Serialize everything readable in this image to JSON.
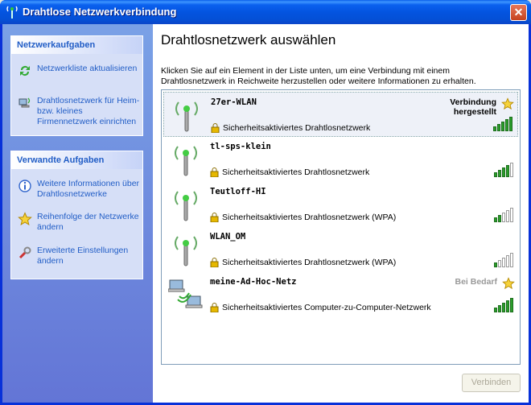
{
  "window": {
    "title": "Drahtlose Netzwerkverbindung",
    "close_icon": "close-icon"
  },
  "tasks": {
    "network_tasks": {
      "title": "Netzwerkaufgaben",
      "items": [
        {
          "label": "Netzwerkliste aktualisieren",
          "icon": "refresh-icon"
        },
        {
          "label": "Drahtlosnetzwerk für Heim- bzw. kleines Firmennetzwerk einrichten",
          "icon": "network-setup-icon"
        }
      ]
    },
    "related_tasks": {
      "title": "Verwandte Aufgaben",
      "items": [
        {
          "label": "Weitere Informationen über Drahtlosnetzwerke",
          "icon": "info-icon"
        },
        {
          "label": "Reihenfolge der Netzwerke ändern",
          "icon": "star-icon"
        },
        {
          "label": "Erweiterte Einstellungen ändern",
          "icon": "tools-icon"
        }
      ]
    }
  },
  "main": {
    "heading": "Drahtlosnetzwerk auswählen",
    "intro": "Klicken Sie auf ein Element in der Liste unten, um eine Verbindung mit einem Drahtlosnetzwerk in Reichweite herzustellen oder weitere Informationen zu erhalten.",
    "networks": [
      {
        "name": "27er-WLAN",
        "security": "Sicherheitsaktiviertes Drahtlosnetzwerk",
        "status_line1": "Verbindung",
        "status_line2": "hergestellt",
        "signal_bars": 5,
        "starred": true,
        "selected": true
      },
      {
        "name": "tl-sps-klein",
        "security": "Sicherheitsaktiviertes Drahtlosnetzwerk",
        "status_line1": "",
        "status_line2": "",
        "signal_bars": 4,
        "starred": false,
        "selected": false
      },
      {
        "name": "Teutloff-HI",
        "security": "Sicherheitsaktiviertes Drahtlosnetzwerk (WPA)",
        "status_line1": "",
        "status_line2": "",
        "signal_bars": 2,
        "starred": false,
        "selected": false
      },
      {
        "name": "WLAN_OM",
        "security": "Sicherheitsaktiviertes Drahtlosnetzwerk (WPA)",
        "status_line1": "",
        "status_line2": "",
        "signal_bars": 1,
        "starred": false,
        "selected": false
      },
      {
        "name": "meine-Ad-Hoc-Netz",
        "security": "Sicherheitsaktiviertes Computer-zu-Computer-Netzwerk",
        "status_line1": "Bei Bedarf",
        "status_line2": "",
        "signal_bars": 5,
        "starred": true,
        "selected": false
      }
    ],
    "connect_button": "Verbinden"
  },
  "colors": {
    "accent": "#215dc6",
    "signal_on": "#2a9d2a",
    "titlebar": "#0454e0"
  }
}
